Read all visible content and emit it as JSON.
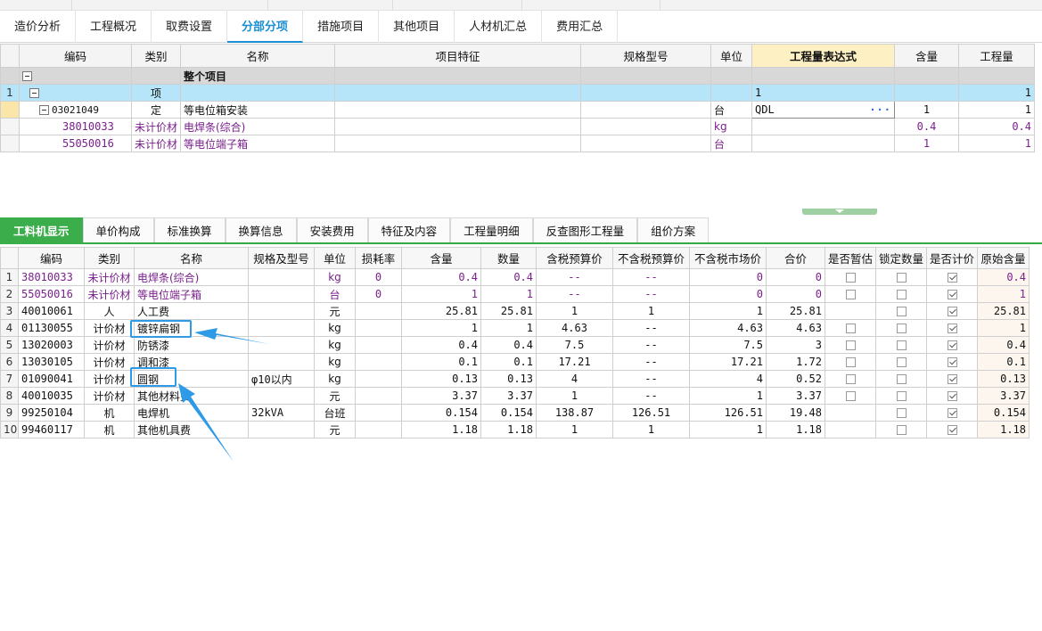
{
  "main_tabs": [
    {
      "label": "造价分析",
      "active": false
    },
    {
      "label": "工程概况",
      "active": false
    },
    {
      "label": "取费设置",
      "active": false
    },
    {
      "label": "分部分项",
      "active": true
    },
    {
      "label": "措施项目",
      "active": false
    },
    {
      "label": "其他项目",
      "active": false
    },
    {
      "label": "人材机汇总",
      "active": false
    },
    {
      "label": "费用汇总",
      "active": false
    }
  ],
  "upper_table": {
    "headers": [
      "编码",
      "类别",
      "名称",
      "项目特征",
      "规格型号",
      "单位",
      "工程量表达式",
      "含量",
      "工程量"
    ],
    "group_row": {
      "name": "整个项目"
    },
    "item_row": {
      "num": "1",
      "type": "项",
      "expr": "1",
      "qty": "1"
    },
    "quota_row": {
      "code": "03021049",
      "type": "定",
      "name": "等电位箱安装",
      "unit": "台",
      "expr": "QDL",
      "content": "1",
      "qty": "1"
    },
    "sub_rows": [
      {
        "code": "38010033",
        "type": "未计价材",
        "name": "电焊条(综合)",
        "unit": "kg",
        "content": "0.4",
        "qty": "0.4"
      },
      {
        "code": "55050016",
        "type": "未计价材",
        "name": "等电位端子箱",
        "unit": "台",
        "content": "1",
        "qty": "1"
      }
    ]
  },
  "sub_tabs": [
    {
      "label": "工料机显示",
      "active": true
    },
    {
      "label": "单价构成",
      "active": false
    },
    {
      "label": "标准换算",
      "active": false
    },
    {
      "label": "换算信息",
      "active": false
    },
    {
      "label": "安装费用",
      "active": false
    },
    {
      "label": "特征及内容",
      "active": false
    },
    {
      "label": "工程量明细",
      "active": false
    },
    {
      "label": "反查图形工程量",
      "active": false
    },
    {
      "label": "组价方案",
      "active": false
    }
  ],
  "lower_table": {
    "headers": [
      "编码",
      "类别",
      "名称",
      "规格及型号",
      "单位",
      "损耗率",
      "含量",
      "数量",
      "含税预算价",
      "不含税预算价",
      "不含税市场价",
      "合价",
      "是否暂估",
      "锁定数量",
      "是否计价",
      "原始含量"
    ],
    "rows": [
      {
        "num": "1",
        "code": "38010033",
        "type": "未计价材",
        "name": "电焊条(综合)",
        "spec": "",
        "unit": "kg",
        "loss": "0",
        "content": "0.4",
        "qty": "0.4",
        "tax_budget": "--",
        "notax_budget": "--",
        "notax_market": "0",
        "total": "0",
        "est": false,
        "lock": false,
        "priced": true,
        "orig": "0.4",
        "purple": true
      },
      {
        "num": "2",
        "code": "55050016",
        "type": "未计价材",
        "name": "等电位端子箱",
        "spec": "",
        "unit": "台",
        "loss": "0",
        "content": "1",
        "qty": "1",
        "tax_budget": "--",
        "notax_budget": "--",
        "notax_market": "0",
        "total": "0",
        "est": false,
        "lock": false,
        "priced": true,
        "orig": "1",
        "purple": true
      },
      {
        "num": "3",
        "code": "40010061",
        "type": "人",
        "name": "人工费",
        "spec": "",
        "unit": "元",
        "loss": "",
        "content": "25.81",
        "qty": "25.81",
        "tax_budget": "1",
        "notax_budget": "1",
        "notax_market": "1",
        "total": "25.81",
        "est": null,
        "lock": false,
        "priced": true,
        "orig": "25.81",
        "purple": false
      },
      {
        "num": "4",
        "code": "01130055",
        "type": "计价材",
        "name": "镀锌扁钢",
        "spec": "",
        "unit": "kg",
        "loss": "",
        "content": "1",
        "qty": "1",
        "tax_budget": "4.63",
        "notax_budget": "--",
        "notax_market": "4.63",
        "total": "4.63",
        "est": false,
        "lock": false,
        "priced": true,
        "orig": "1",
        "purple": false
      },
      {
        "num": "5",
        "code": "13020003",
        "type": "计价材",
        "name": "防锈漆",
        "spec": "",
        "unit": "kg",
        "loss": "",
        "content": "0.4",
        "qty": "0.4",
        "tax_budget": "7.5",
        "notax_budget": "--",
        "notax_market": "7.5",
        "total": "3",
        "est": false,
        "lock": false,
        "priced": true,
        "orig": "0.4",
        "purple": false
      },
      {
        "num": "6",
        "code": "13030105",
        "type": "计价材",
        "name": "调和漆",
        "spec": "",
        "unit": "kg",
        "loss": "",
        "content": "0.1",
        "qty": "0.1",
        "tax_budget": "17.21",
        "notax_budget": "--",
        "notax_market": "17.21",
        "total": "1.72",
        "est": false,
        "lock": false,
        "priced": true,
        "orig": "0.1",
        "purple": false
      },
      {
        "num": "7",
        "code": "01090041",
        "type": "计价材",
        "name": "圆钢",
        "spec": "φ10以内",
        "unit": "kg",
        "loss": "",
        "content": "0.13",
        "qty": "0.13",
        "tax_budget": "4",
        "notax_budget": "--",
        "notax_market": "4",
        "total": "0.52",
        "est": false,
        "lock": false,
        "priced": true,
        "orig": "0.13",
        "purple": false
      },
      {
        "num": "8",
        "code": "40010035",
        "type": "计价材",
        "name": "其他材料费",
        "spec": "",
        "unit": "元",
        "loss": "",
        "content": "3.37",
        "qty": "3.37",
        "tax_budget": "1",
        "notax_budget": "--",
        "notax_market": "1",
        "total": "3.37",
        "est": false,
        "lock": false,
        "priced": true,
        "orig": "3.37",
        "purple": false
      },
      {
        "num": "9",
        "code": "99250104",
        "type": "机",
        "name": "电焊机",
        "spec": "32kVA",
        "unit": "台班",
        "loss": "",
        "content": "0.154",
        "qty": "0.154",
        "tax_budget": "138.87",
        "notax_budget": "126.51",
        "notax_market": "126.51",
        "total": "19.48",
        "est": null,
        "lock": false,
        "priced": true,
        "orig": "0.154",
        "purple": false
      },
      {
        "num": "10",
        "code": "99460117",
        "type": "机",
        "name": "其他机具费",
        "spec": "",
        "unit": "元",
        "loss": "",
        "content": "1.18",
        "qty": "1.18",
        "tax_budget": "1",
        "notax_budget": "1",
        "notax_market": "1",
        "total": "1.18",
        "est": null,
        "lock": false,
        "priced": true,
        "orig": "1.18",
        "purple": false
      }
    ]
  },
  "colors": {
    "accent_blue": "#1a8fd4",
    "active_green": "#3cad4b",
    "annotation_blue": "#2f9ae6",
    "purple_text": "#7a1f8c"
  }
}
